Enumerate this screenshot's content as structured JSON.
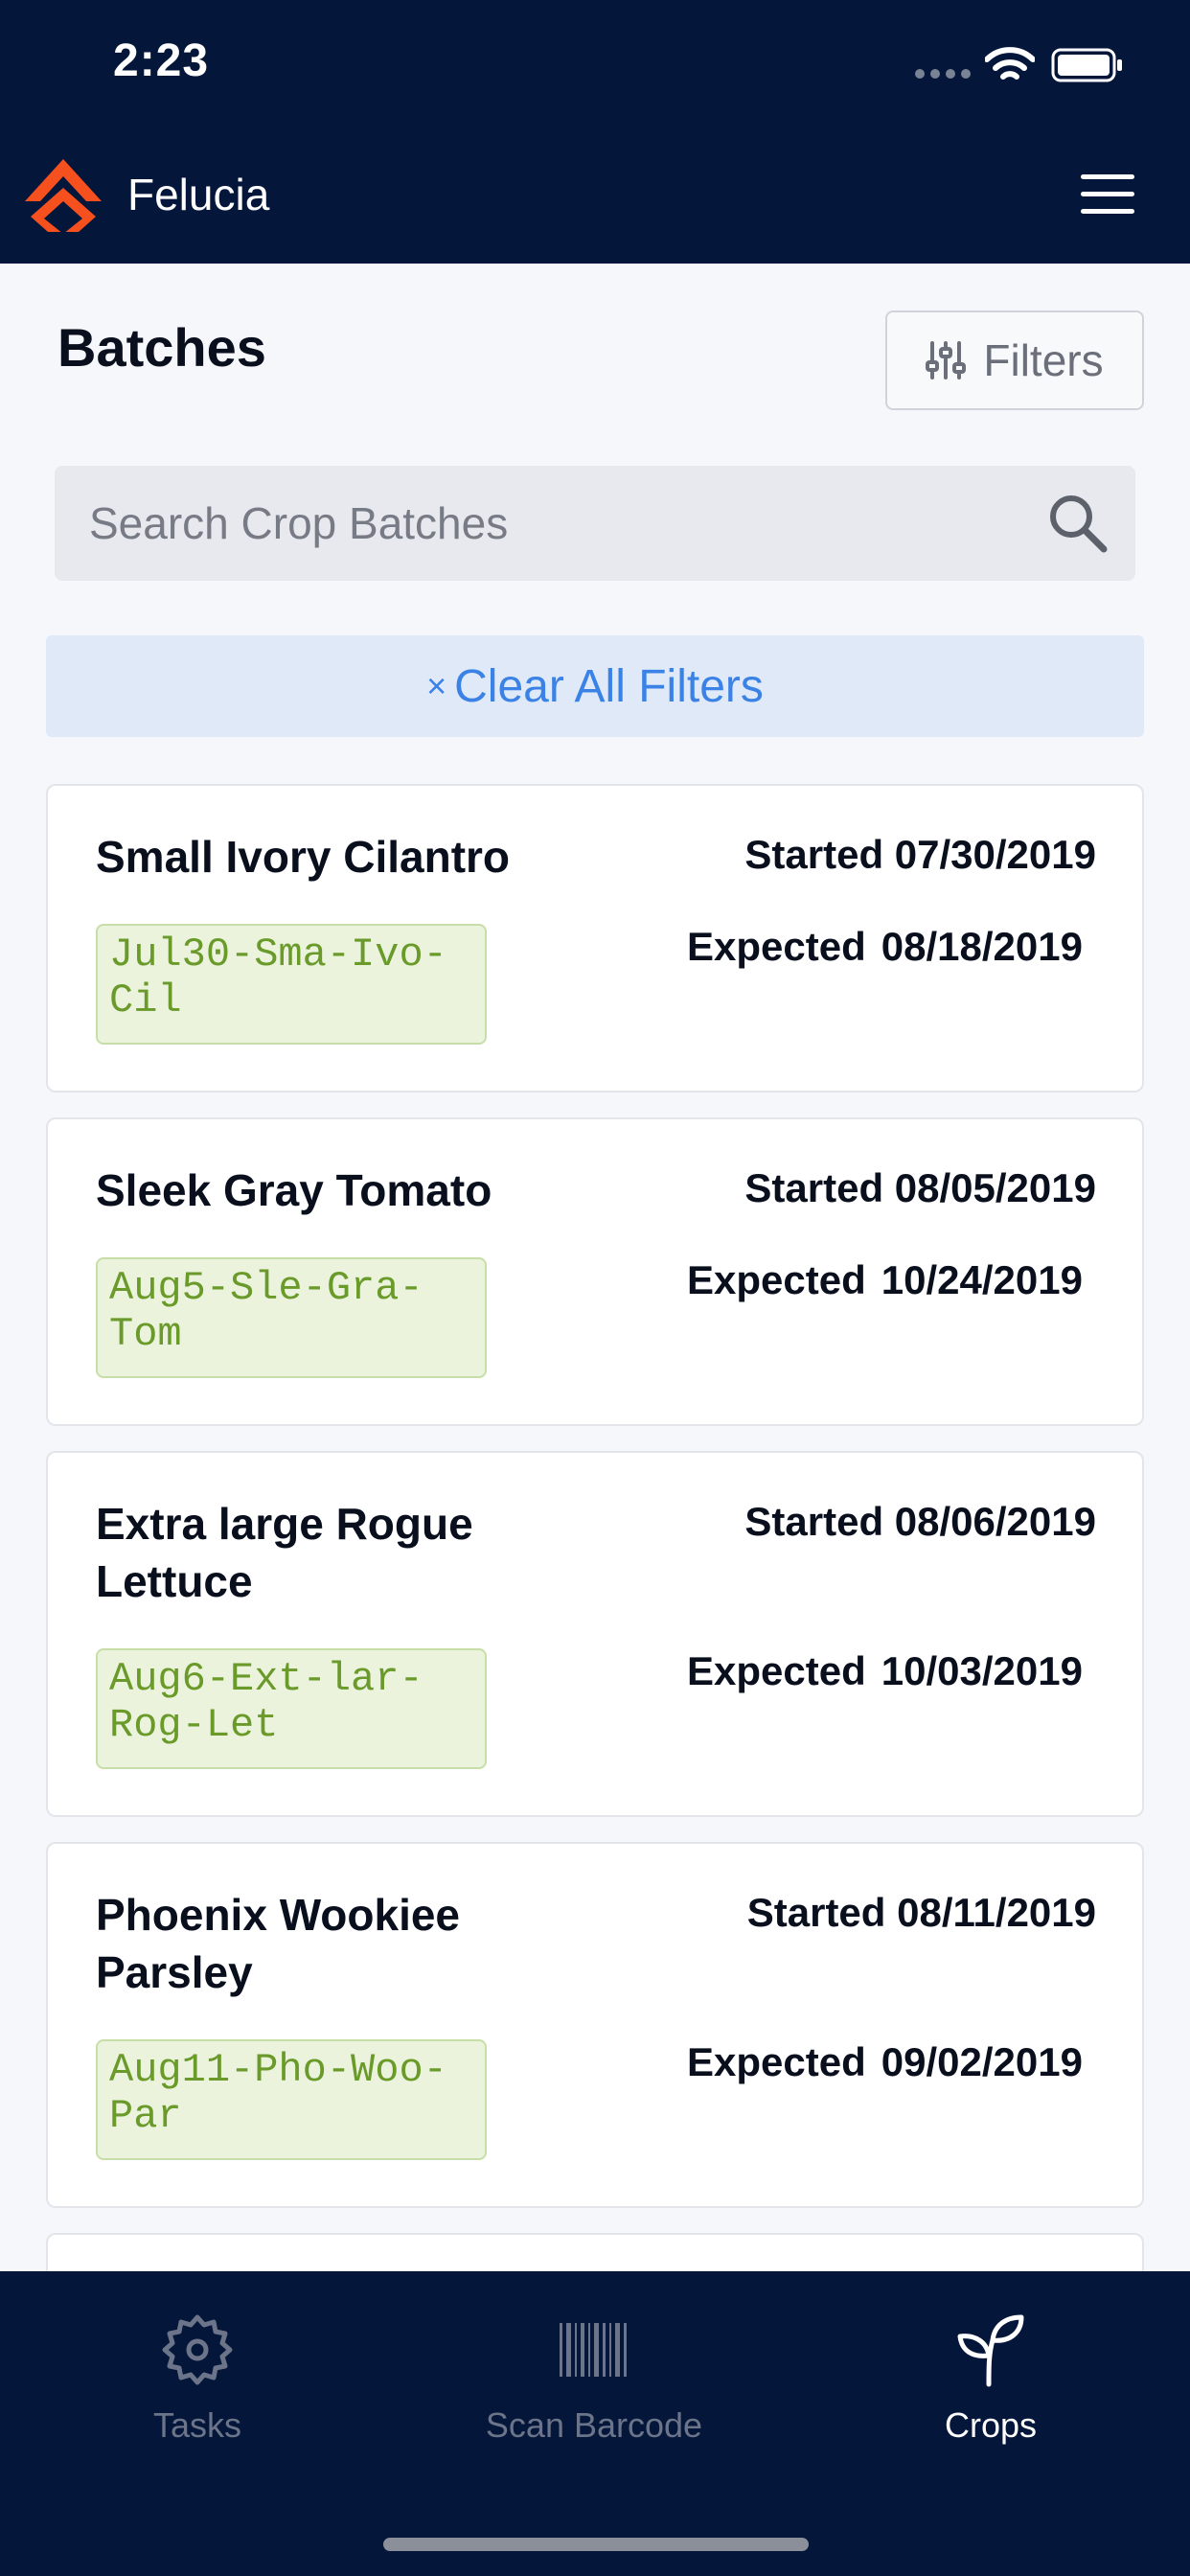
{
  "status_bar": {
    "time": "2:23"
  },
  "header": {
    "app_name": "Felucia"
  },
  "page": {
    "title": "Batches",
    "filters_label": "Filters"
  },
  "search": {
    "placeholder": "Search Crop Batches"
  },
  "clear_filters": {
    "icon": "×",
    "label": "Clear All Filters"
  },
  "batches": [
    {
      "name": "Small Ivory Cilantro",
      "code": "Jul30-Sma-Ivo-Cil",
      "started_label": "Started",
      "started": "07/30/2019",
      "expected_label": "Expected",
      "expected": "08/18/2019"
    },
    {
      "name": "Sleek Gray Tomato",
      "code": "Aug5-Sle-Gra-Tom",
      "started_label": "Started",
      "started": "08/05/2019",
      "expected_label": "Expected",
      "expected": "10/24/2019"
    },
    {
      "name": "Extra large Rogue Lettuce",
      "code": "Aug6-Ext-lar-Rog-Let",
      "started_label": "Started",
      "started": "08/06/2019",
      "expected_label": "Expected",
      "expected": "10/03/2019"
    },
    {
      "name": "Phoenix Wookiee Parsley",
      "code": "Aug11-Pho-Woo-Par",
      "started_label": "Started",
      "started": "08/11/2019",
      "expected_label": "Expected",
      "expected": "09/02/2019"
    }
  ],
  "tabs": [
    {
      "label": "Tasks",
      "icon": "gear-icon",
      "active": false
    },
    {
      "label": "Scan Barcode",
      "icon": "barcode-icon",
      "active": false
    },
    {
      "label": "Crops",
      "icon": "sprout-icon",
      "active": true
    }
  ],
  "colors": {
    "nav_bg": "#04163a",
    "accent_blue": "#3b82e6",
    "logo_orange": "#f5501e",
    "code_green": "#6a9a2a"
  }
}
